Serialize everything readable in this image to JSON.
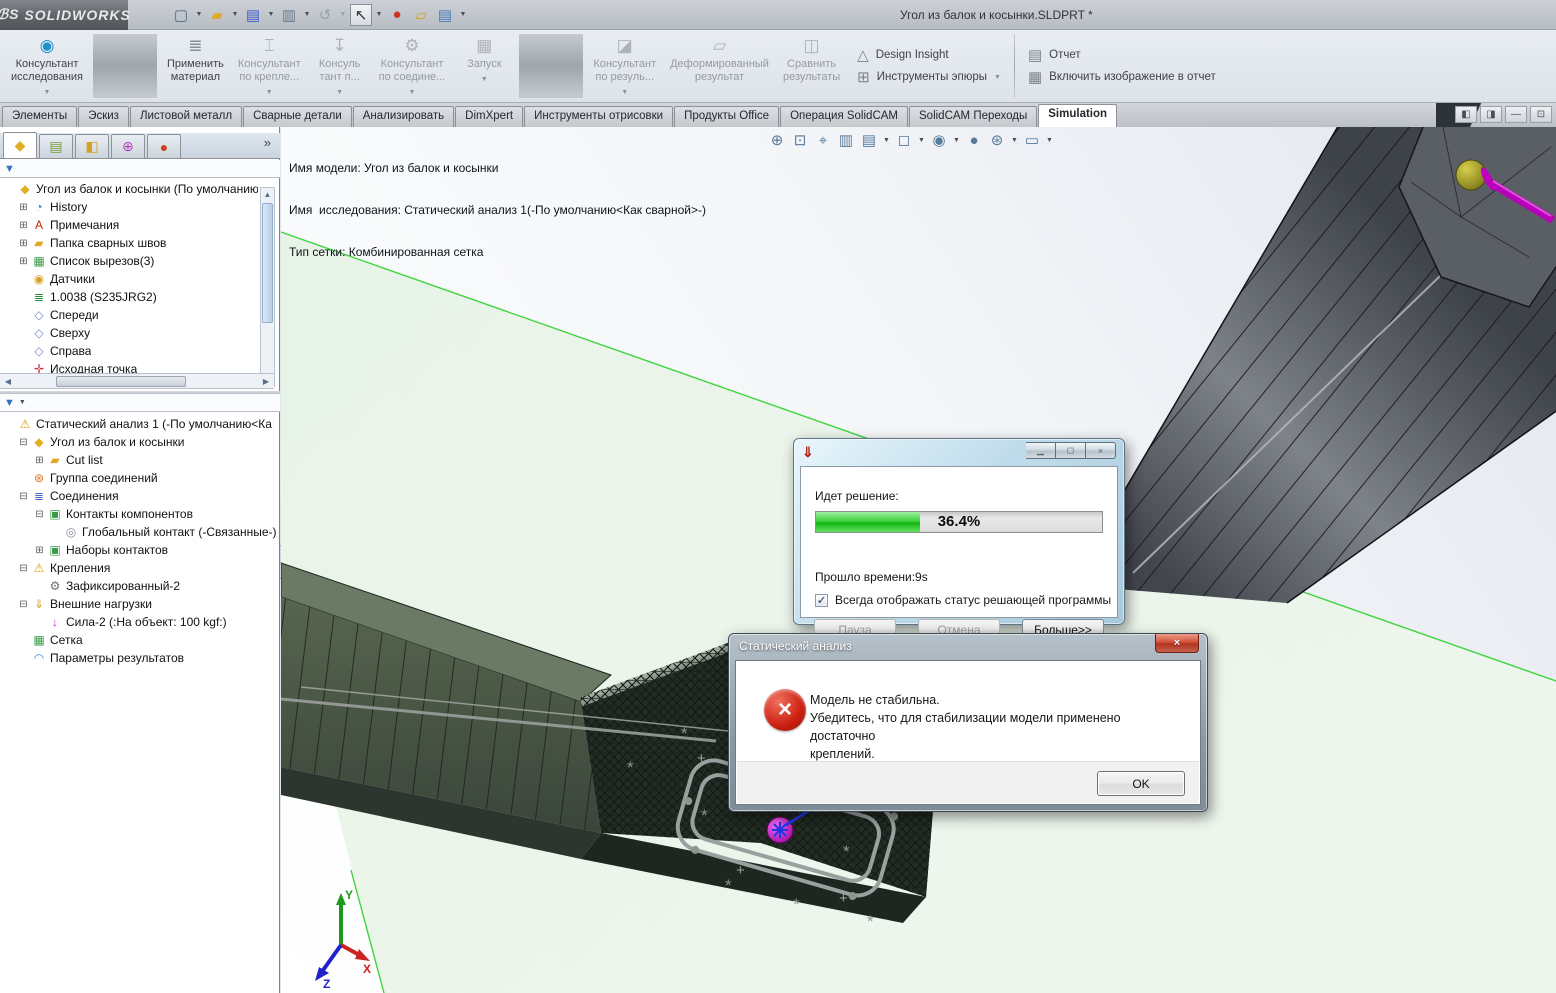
{
  "colors": {
    "progress_green": "#22c022",
    "plane_edge_green": "#3fd43f",
    "error_red": "#cc1f10",
    "beam_gray": "#5a5f66",
    "beam_dark_green": "#39453c",
    "force_magenta": "#cc22cc"
  },
  "titlebar": {
    "logo": "SOLIDWORKS",
    "doc_title": "Угол из балок и косынки.SLDPRT *",
    "icons": [
      {
        "name": "new-document-icon",
        "g": "▢",
        "c": "#4a6a8a",
        "cls": ""
      },
      {
        "name": "dropdown-arrow-icon",
        "g": "▼",
        "c": "#4a4f55",
        "cls": "qar"
      },
      {
        "name": "open-folder-icon",
        "g": "▰",
        "c": "#e0a82a",
        "cls": ""
      },
      {
        "name": "dropdown-arrow-icon",
        "g": "▼",
        "c": "#4a4f55",
        "cls": "qar"
      },
      {
        "name": "save-icon",
        "g": "▤",
        "c": "#3a5ad0",
        "cls": ""
      },
      {
        "name": "dropdown-arrow-icon",
        "g": "▼",
        "c": "#4a4f55",
        "cls": "qar"
      },
      {
        "name": "print-icon",
        "g": "▥",
        "c": "#6a7a8a",
        "cls": ""
      },
      {
        "name": "dropdown-arrow-icon",
        "g": "▼",
        "c": "#4a4f55",
        "cls": "qar"
      },
      {
        "name": "undo-icon",
        "g": "↺",
        "c": "#9aa2ab",
        "cls": ""
      },
      {
        "name": "dropdown-arrow-icon",
        "g": "▼",
        "c": "#9aa2ab",
        "cls": "qar"
      },
      {
        "name": "select-arrow-icon",
        "g": "↖",
        "c": "#2a2e33",
        "cls": "qsel"
      },
      {
        "name": "dropdown-arrow-icon",
        "g": "▼",
        "c": "#4a4f55",
        "cls": "qar"
      },
      {
        "name": "traffic-light-icon",
        "g": "●",
        "c": "#cc3322",
        "cls": ""
      },
      {
        "name": "annotation-note-icon",
        "g": "▱",
        "c": "#d8a020",
        "cls": ""
      },
      {
        "name": "checklist-icon",
        "g": "▤",
        "c": "#4a7ac0",
        "cls": ""
      },
      {
        "name": "dropdown-arrow-icon",
        "g": "▼",
        "c": "#4a4f55",
        "cls": "qar"
      }
    ]
  },
  "ribbon": {
    "buttons": [
      {
        "name": "study-advisor-button",
        "cls": "",
        "g": "◉",
        "gc": "#1f8fd0",
        "l1": "Консультант",
        "l2": "исследования",
        "ar": "▼"
      },
      {
        "name": "divider",
        "cls": "rdiv",
        "g": "",
        "gc": "",
        "l1": "",
        "l2": "",
        "ar": ""
      },
      {
        "name": "apply-material-button",
        "cls": "",
        "g": "≣",
        "gc": "#8a9098",
        "l1": "Применить",
        "l2": "материал",
        "ar": ""
      },
      {
        "name": "fixtures-advisor-button",
        "cls": "disabled",
        "g": "⌶",
        "gc": "",
        "l1": "Консультант",
        "l2": "по крепле...",
        "ar": "▼"
      },
      {
        "name": "loads-advisor-button",
        "cls": "disabled",
        "g": "↧",
        "gc": "",
        "l1": "Консуль",
        "l2": "тант п...",
        "ar": "▼"
      },
      {
        "name": "connections-advisor-button",
        "cls": "disabled",
        "g": "⚙",
        "gc": "",
        "l1": "Консультант",
        "l2": "по соедине...",
        "ar": "▼"
      },
      {
        "name": "run-button",
        "cls": "disabled",
        "g": "▦",
        "gc": "",
        "l1": "Запуск",
        "l2": "",
        "ar": "▼"
      },
      {
        "name": "divider",
        "cls": "rdiv",
        "g": "",
        "gc": "",
        "l1": "",
        "l2": "",
        "ar": ""
      },
      {
        "name": "results-advisor-button",
        "cls": "disabled",
        "g": "◪",
        "gc": "",
        "l1": "Консультант",
        "l2": "по резуль...",
        "ar": "▼"
      },
      {
        "name": "deformed-result-button",
        "cls": "disabled",
        "g": "▱",
        "gc": "",
        "l1": "Деформированный",
        "l2": "результат",
        "ar": ""
      },
      {
        "name": "compare-results-button",
        "cls": "disabled",
        "g": "◫",
        "gc": "",
        "l1": "Сравнить",
        "l2": "результаты",
        "ar": ""
      }
    ],
    "insight_rows": [
      {
        "name": "design-insight-button",
        "g": "△",
        "label": "Design Insight",
        "ar": ""
      },
      {
        "name": "plot-tools-button",
        "g": "⊞",
        "label": "Инструменты эпюры",
        "ar": "▼"
      }
    ],
    "report_rows": [
      {
        "name": "report-button",
        "g": "▤",
        "label": "Отчет",
        "ar": ""
      },
      {
        "name": "include-image-in-report-button",
        "g": "▦",
        "label": "Включить изображение в отчет",
        "ar": ""
      }
    ]
  },
  "tabs": [
    {
      "name": "tab-features",
      "label": "Элементы",
      "cls": ""
    },
    {
      "name": "tab-sketch",
      "label": "Эскиз",
      "cls": ""
    },
    {
      "name": "tab-sheet-metal",
      "label": "Листовой металл",
      "cls": ""
    },
    {
      "name": "tab-weldments",
      "label": "Сварные детали",
      "cls": ""
    },
    {
      "name": "tab-evaluate",
      "label": "Анализировать",
      "cls": ""
    },
    {
      "name": "tab-dimxpert",
      "label": "DimXpert",
      "cls": ""
    },
    {
      "name": "tab-render-tools",
      "label": "Инструменты отрисовки",
      "cls": ""
    },
    {
      "name": "tab-office-products",
      "label": "Продукты Office",
      "cls": ""
    },
    {
      "name": "tab-solidcam-operation",
      "label": "Операция  SolidCAM",
      "cls": ""
    },
    {
      "name": "tab-solidcam-transitions",
      "label": "SolidCAM Переходы",
      "cls": ""
    },
    {
      "name": "tab-simulation",
      "label": "Simulation",
      "cls": "active"
    }
  ],
  "doc_controls": [
    {
      "name": "split-left-icon",
      "g": "◧"
    },
    {
      "name": "split-right-icon",
      "g": "◨"
    },
    {
      "name": "minimize-doc-icon",
      "g": "—"
    },
    {
      "name": "restore-doc-icon",
      "g": "⊡"
    }
  ],
  "panel": {
    "manager_tabs": [
      {
        "name": "featuremanager-tab",
        "g": "◆",
        "c": "#e0b020",
        "cls": "active"
      },
      {
        "name": "propertymanager-tab",
        "g": "▤",
        "c": "#7a9a3a",
        "cls": ""
      },
      {
        "name": "configurationmanager-tab",
        "g": "◧",
        "c": "#d8a020",
        "cls": ""
      },
      {
        "name": "dimxpertmanager-tab",
        "g": "⊕",
        "c": "#b040c0",
        "cls": ""
      },
      {
        "name": "displaymanager-tab",
        "g": "●",
        "c": "#d04020",
        "cls": ""
      }
    ],
    "more_chevron": "»",
    "tree_top": [
      {
        "name": "tree-item-part-root",
        "label": "Угол из балок и косынки  (По умолчанию<",
        "g": "◆",
        "gc": "#e0b020",
        "cls": "ind0",
        "exp": ""
      },
      {
        "name": "tree-item-history",
        "label": "History",
        "g": "◔",
        "gc": "#3a78c8",
        "cls": "ind1",
        "exp": "⊞"
      },
      {
        "name": "tree-item-annotations",
        "label": "Примечания",
        "g": "A",
        "gc": "#cc2200",
        "cls": "ind1",
        "exp": "⊞"
      },
      {
        "name": "tree-item-weld-folder",
        "label": "Папка сварных швов",
        "g": "▰",
        "gc": "#e0a82a",
        "cls": "ind1",
        "exp": "⊞"
      },
      {
        "name": "tree-item-cutlist",
        "label": "Список вырезов(3)",
        "g": "▦",
        "gc": "#3a9a4a",
        "cls": "ind1",
        "exp": "⊞"
      },
      {
        "name": "tree-item-sensors",
        "label": "Датчики",
        "g": "◉",
        "gc": "#d8a020",
        "cls": "ind1",
        "exp": ""
      },
      {
        "name": "tree-item-material",
        "label": "1.0038 (S235JRG2)",
        "g": "≣",
        "gc": "#2a8a3a",
        "cls": "ind1",
        "exp": ""
      },
      {
        "name": "tree-item-front-plane",
        "label": "Спереди",
        "g": "◇",
        "gc": "#7a86c8",
        "cls": "ind1",
        "exp": ""
      },
      {
        "name": "tree-item-top-plane",
        "label": "Сверху",
        "g": "◇",
        "gc": "#7a86c8",
        "cls": "ind1",
        "exp": ""
      },
      {
        "name": "tree-item-right-plane",
        "label": "Справа",
        "g": "◇",
        "gc": "#7a86c8",
        "cls": "ind1",
        "exp": ""
      },
      {
        "name": "tree-item-origin",
        "label": "Исходная точка",
        "g": "✛",
        "gc": "#cc3344",
        "cls": "ind1",
        "exp": ""
      }
    ],
    "tree_sim": [
      {
        "name": "sim-item-static-study",
        "label": "Статический анализ 1 (-По умолчанию<Ка",
        "g": "⚠",
        "gc": "#e0a000",
        "cls": "ind0",
        "exp": ""
      },
      {
        "name": "sim-item-part",
        "label": "Угол из балок и косынки",
        "g": "◆",
        "gc": "#e0b020",
        "cls": "ind1",
        "exp": "⊟"
      },
      {
        "name": "sim-item-cut-list",
        "label": "Cut list",
        "g": "▰",
        "gc": "#e0a82a",
        "cls": "ind2",
        "exp": "⊞"
      },
      {
        "name": "sim-item-joint-group",
        "label": "Группа соединений",
        "g": "⊛",
        "gc": "#e07020",
        "cls": "ind1",
        "exp": ""
      },
      {
        "name": "sim-item-connections",
        "label": "Соединения",
        "g": "≣",
        "gc": "#4a6ad0",
        "cls": "ind1",
        "exp": "⊟"
      },
      {
        "name": "sim-item-component-contacts",
        "label": "Контакты компонентов",
        "g": "▣",
        "gc": "#3a9a4a",
        "cls": "ind2",
        "exp": "⊟"
      },
      {
        "name": "sim-item-global-contact",
        "label": "Глобальный контакт (-Связанные-)",
        "g": "◎",
        "gc": "#8a8a9a",
        "cls": "ind3",
        "exp": ""
      },
      {
        "name": "sim-item-contact-sets",
        "label": "Наборы контактов",
        "g": "▣",
        "gc": "#3a9a4a",
        "cls": "ind2",
        "exp": "⊞"
      },
      {
        "name": "sim-item-fixtures",
        "label": "Крепления",
        "g": "⚠",
        "gc": "#e0a000",
        "cls": "ind1",
        "exp": "⊟"
      },
      {
        "name": "sim-item-fixed-2",
        "label": "Зафиксированный-2",
        "g": "⚙",
        "gc": "#6a6a72",
        "cls": "ind2",
        "exp": ""
      },
      {
        "name": "sim-item-external-loads",
        "label": "Внешние нагрузки",
        "g": "⇓",
        "gc": "#d8a020",
        "cls": "ind1",
        "exp": "⊟"
      },
      {
        "name": "sim-item-force-2",
        "label": "Сила-2 (:На объект: 100 kgf:)",
        "g": "↓",
        "gc": "#cc22cc",
        "cls": "ind2",
        "exp": ""
      },
      {
        "name": "sim-item-mesh",
        "label": "Сетка",
        "g": "▦",
        "gc": "#3a9a4a",
        "cls": "ind1",
        "exp": ""
      },
      {
        "name": "sim-item-result-options",
        "label": "Параметры результатов",
        "g": "◠",
        "gc": "#4a8ac0",
        "cls": "ind1",
        "exp": ""
      }
    ]
  },
  "viewport": {
    "info_line1": "Имя модели: Угол из балок и косынки",
    "info_line2": "Имя  исследования: Статический анализ 1(-По умолчанию<Как сварной>-)",
    "info_line3": "Тип сетки: Комбинированная сетка",
    "hud_icons": [
      {
        "name": "zoom-fit-icon",
        "g": "⊕",
        "cls": ""
      },
      {
        "name": "zoom-area-icon",
        "g": "⊡",
        "cls": ""
      },
      {
        "name": "zoom-selection-icon",
        "g": "⌖",
        "cls": ""
      },
      {
        "name": "section-view-icon",
        "g": "▥",
        "cls": ""
      },
      {
        "name": "view-settings-icon",
        "g": "▤",
        "cls": ""
      },
      {
        "name": "dropdown-arrow-icon",
        "g": "▼",
        "cls": "har"
      },
      {
        "name": "view-orientation-icon",
        "g": "◻",
        "cls": ""
      },
      {
        "name": "dropdown-arrow-icon",
        "g": "▼",
        "cls": "har"
      },
      {
        "name": "display-style-icon",
        "g": "◉",
        "cls": ""
      },
      {
        "name": "dropdown-arrow-icon",
        "g": "▼",
        "cls": "har"
      },
      {
        "name": "appearance-icon",
        "g": "●",
        "cls": ""
      },
      {
        "name": "scene-icon",
        "g": "⊛",
        "cls": ""
      },
      {
        "name": "dropdown-arrow-icon",
        "g": "▼",
        "cls": "har"
      },
      {
        "name": "camera-view-icon",
        "g": "▭",
        "cls": ""
      },
      {
        "name": "dropdown-arrow-icon",
        "g": "▼",
        "cls": "har"
      }
    ],
    "triad": {
      "x_label": "X",
      "y_label": "Y",
      "z_label": "Z"
    }
  },
  "progress_dialog": {
    "solver_icon": "⇓",
    "status_label": "Идет решение:",
    "percent_label": "36.4%",
    "percent_value": 36.4,
    "elapsed_label": "Прошло времени:9s",
    "checkbox_checked": "✓",
    "checkbox_label": "Всегда отображать статус решающей программы",
    "pause_button": "Пауза",
    "cancel_button": "Отмена",
    "more_button": "Больше>>",
    "window_buttons": [
      {
        "name": "minimize-icon",
        "g": "▁"
      },
      {
        "name": "maximize-icon",
        "g": "◻"
      },
      {
        "name": "close-icon",
        "g": "×"
      }
    ]
  },
  "error_dialog": {
    "title": "Статический анализ",
    "close_glyph": "×",
    "error_icon": "×",
    "message_line1": "Модель не стабильна.",
    "message_line2": "Убедитесь, что для стабилизации модели применено достаточно",
    "message_line3": "креплений.",
    "ok_button": "OK"
  }
}
